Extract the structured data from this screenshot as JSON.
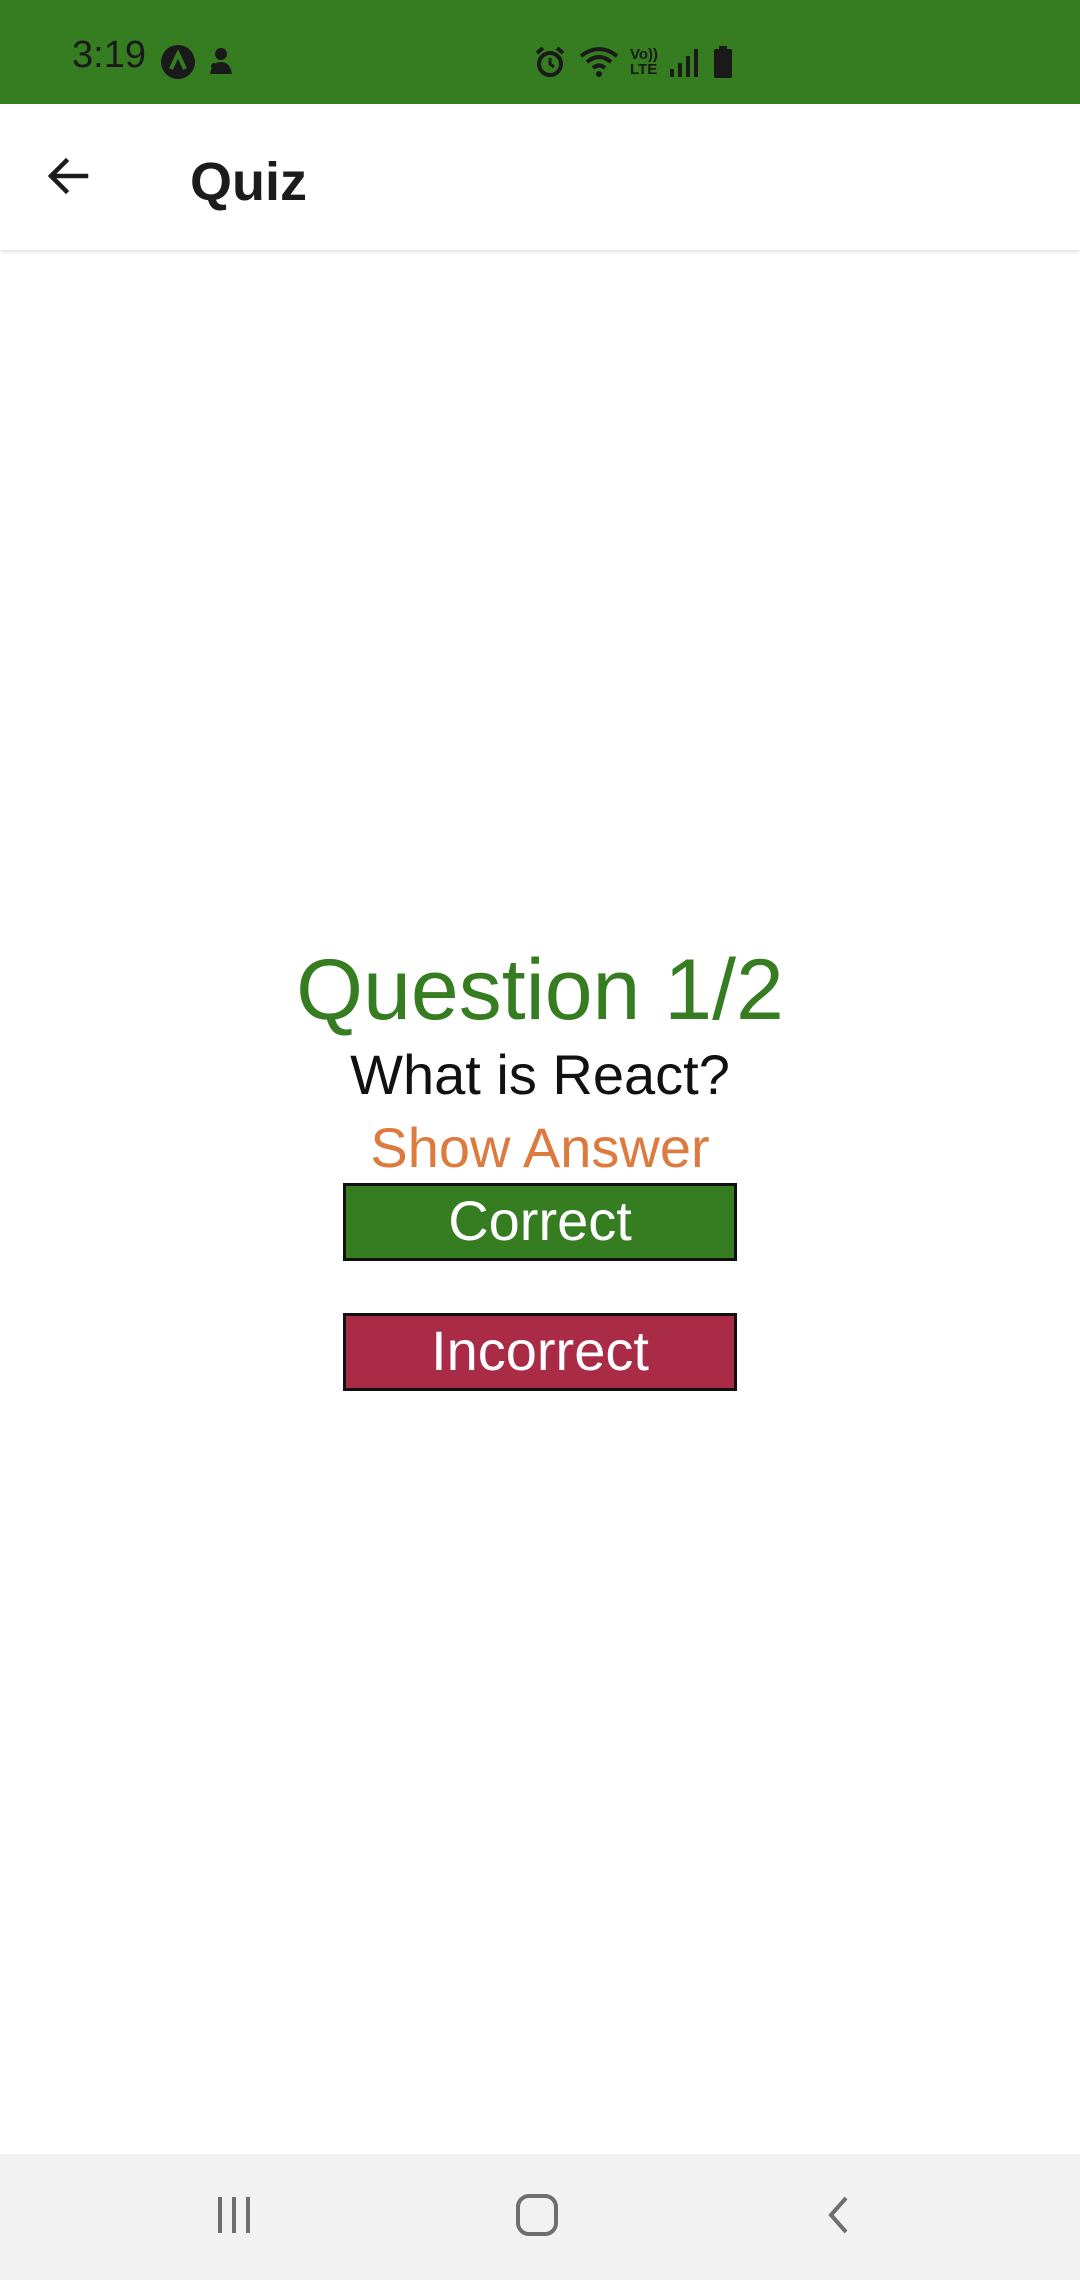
{
  "status_bar": {
    "time": "3:19",
    "background": "#367d21",
    "left_icons": [
      "a-circle-icon",
      "notification-person-icon"
    ],
    "right_icons": [
      "alarm-icon",
      "wifi-icon",
      "volte-icon",
      "signal-icon",
      "battery-icon"
    ],
    "volte_label_top": "Vo))",
    "volte_label_bottom": "LTE"
  },
  "app_bar": {
    "title": "Quiz",
    "back_icon": "arrow-left-icon"
  },
  "quiz": {
    "counter": "Question 1/2",
    "question": "What is React?",
    "show_answer_label": "Show Answer",
    "correct_label": "Correct",
    "incorrect_label": "Incorrect"
  },
  "colors": {
    "primary_green": "#367d21",
    "accent_orange": "#dd7a3d",
    "incorrect_red": "#a92b46"
  },
  "nav_bar": {
    "icons": [
      "recent-apps-icon",
      "home-icon",
      "back-icon"
    ]
  }
}
